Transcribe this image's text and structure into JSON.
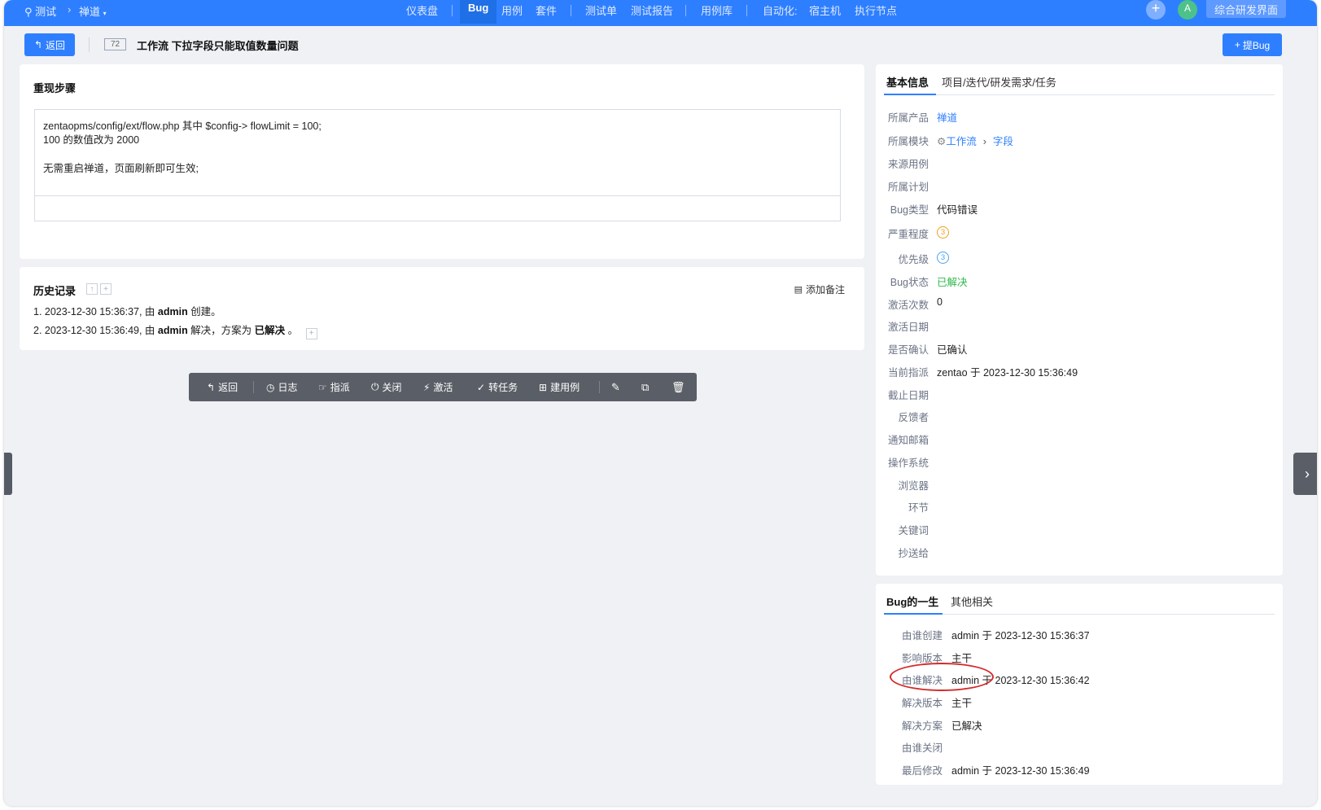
{
  "topnav": {
    "crumb_test": "测试",
    "crumb_product": "禅道",
    "items": [
      "仪表盘",
      "Bug",
      "用例",
      "套件",
      "测试单",
      "测试报告",
      "用例库",
      "自动化:",
      "宿主机",
      "执行节点"
    ],
    "avatar_letter": "A",
    "mix_button": "综合研发界面"
  },
  "header": {
    "back_label": "返回",
    "bug_id": "72",
    "bug_title": "工作流 下拉字段只能取值数量问题",
    "new_bug_label": "提Bug"
  },
  "steps": {
    "title": "重现步骤",
    "lines": [
      "zentaopms/config/ext/flow.php 其中 $config-> flowLimit = 100;",
      "100 的数值改为 2000",
      "无需重启禅道，页面刷新即可生效;"
    ]
  },
  "history": {
    "title": "历史记录",
    "add_note": "添加备注",
    "entries": [
      {
        "prefix": "1. 2023-12-30 15:36:37, 由 ",
        "user": "admin",
        "suffix": " 创建。"
      },
      {
        "prefix": "2. 2023-12-30 15:36:49, 由 ",
        "user": "admin",
        "mid": " 解决，方案为 ",
        "result": "已解决",
        "suffix": " 。"
      }
    ]
  },
  "toolbar": {
    "back": "返回",
    "log": "日志",
    "assign": "指派",
    "close": "关闭",
    "activate": "激活",
    "to_task": "转任务",
    "create_case": "建用例"
  },
  "basic_info": {
    "tabs": [
      "基本信息",
      "项目/迭代/研发需求/任务"
    ],
    "fields": [
      {
        "label": "所属产品",
        "value": "禅道"
      },
      {
        "label": "所属模块",
        "value": "工作流",
        "value2": "字段"
      },
      {
        "label": "来源用例",
        "value": ""
      },
      {
        "label": "所属计划",
        "value": ""
      },
      {
        "label": "Bug类型",
        "value": "代码错误"
      },
      {
        "label": "严重程度",
        "value": "3"
      },
      {
        "label": "优先级",
        "value": "3"
      },
      {
        "label": "Bug状态",
        "value": "已解决"
      },
      {
        "label": "激活次数",
        "value": "0"
      },
      {
        "label": "激活日期",
        "value": ""
      },
      {
        "label": "是否确认",
        "value": "已确认"
      },
      {
        "label": "当前指派",
        "value": "zentao 于 2023-12-30 15:36:49"
      },
      {
        "label": "截止日期",
        "value": ""
      },
      {
        "label": "反馈者",
        "value": ""
      },
      {
        "label": "通知邮箱",
        "value": ""
      },
      {
        "label": "操作系统",
        "value": ""
      },
      {
        "label": "浏览器",
        "value": ""
      },
      {
        "label": "环节",
        "value": ""
      },
      {
        "label": "关键词",
        "value": ""
      },
      {
        "label": "抄送给",
        "value": ""
      }
    ]
  },
  "bug_life": {
    "tabs": [
      "Bug的一生",
      "其他相关"
    ],
    "fields": [
      {
        "label": "由谁创建",
        "value": "admin 于 2023-12-30 15:36:37"
      },
      {
        "label": "影响版本",
        "value": "主干"
      },
      {
        "label": "由谁解决",
        "value": "admin 于 2023-12-30 15:36:42"
      },
      {
        "label": "解决版本",
        "value": "主干"
      },
      {
        "label": "解决方案",
        "value": "已解决"
      },
      {
        "label": "由谁关闭",
        "value": ""
      },
      {
        "label": "最后修改",
        "value": "admin 于 2023-12-30 15:36:49"
      }
    ]
  },
  "colors": {
    "primary": "#2e7fff",
    "resolved_green": "#2eb84b",
    "severity_orange": "#f0a020",
    "priority_blue": "#4aa3f0",
    "annotation_red": "#d42b2b"
  }
}
